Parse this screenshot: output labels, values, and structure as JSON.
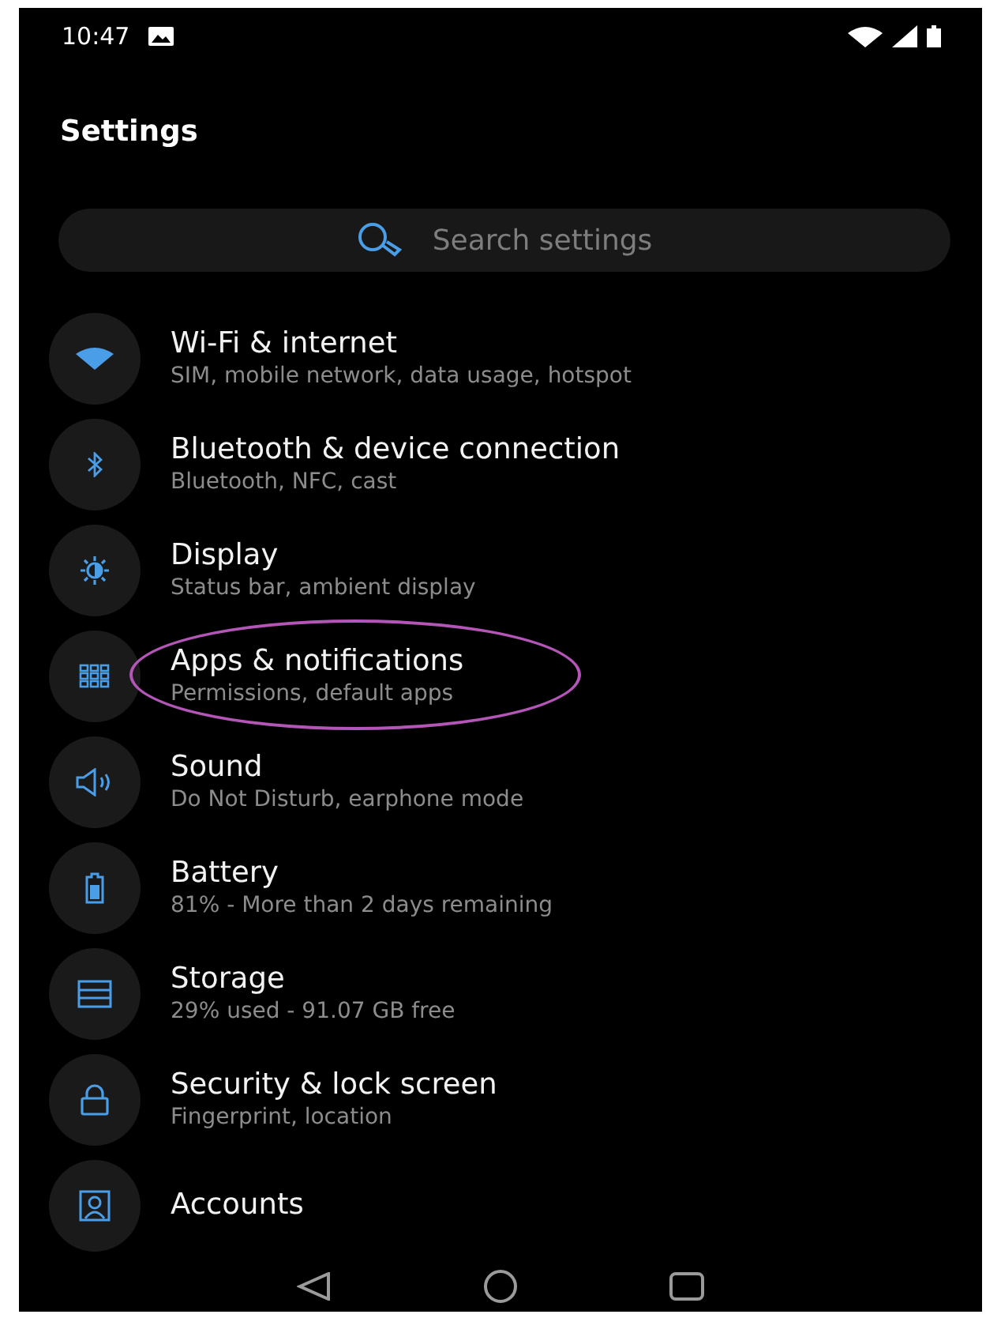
{
  "status_bar": {
    "time": "10:47"
  },
  "title": "Settings",
  "search": {
    "placeholder": "Search settings"
  },
  "items": [
    {
      "kind": "wifi",
      "title": "Wi-Fi & internet",
      "subtitle": "SIM, mobile network, data usage, hotspot",
      "highlighted": false
    },
    {
      "kind": "bluetooth",
      "title": "Bluetooth & device connection",
      "subtitle": "Bluetooth, NFC, cast",
      "highlighted": false
    },
    {
      "kind": "display",
      "title": "Display",
      "subtitle": "Status bar, ambient display",
      "highlighted": false
    },
    {
      "kind": "apps",
      "title": "Apps & notifications",
      "subtitle": "Permissions, default apps",
      "highlighted": true
    },
    {
      "kind": "sound",
      "title": "Sound",
      "subtitle": "Do Not Disturb, earphone mode",
      "highlighted": false
    },
    {
      "kind": "battery",
      "title": "Battery",
      "subtitle": "81% - More than 2 days remaining",
      "highlighted": false
    },
    {
      "kind": "storage",
      "title": "Storage",
      "subtitle": "29% used - 91.07 GB free",
      "highlighted": false
    },
    {
      "kind": "security",
      "title": "Security & lock screen",
      "subtitle": "Fingerprint, location",
      "highlighted": false
    },
    {
      "kind": "accounts",
      "title": "Accounts",
      "highlighted": false
    }
  ]
}
